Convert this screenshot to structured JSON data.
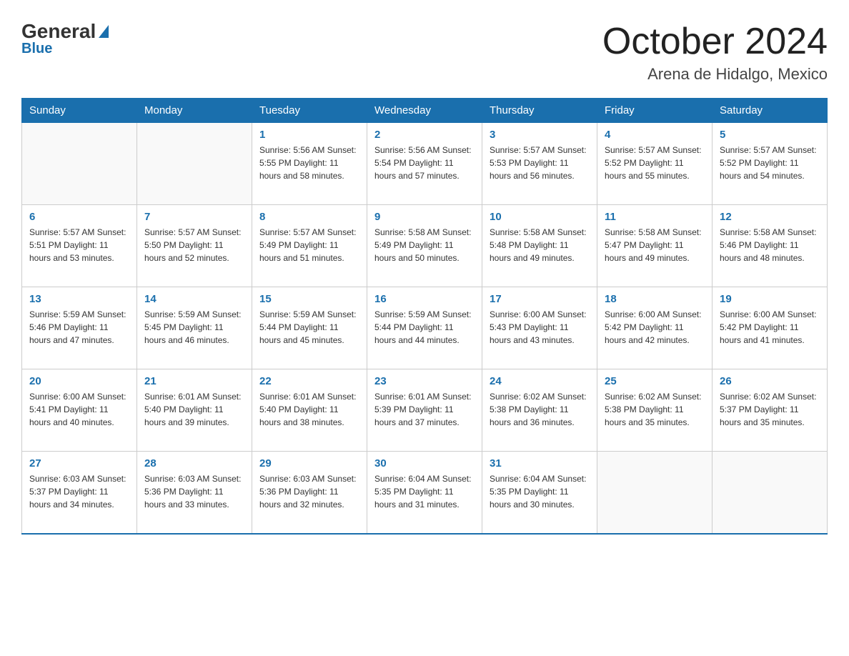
{
  "logo": {
    "general": "General",
    "blue": "Blue"
  },
  "title": "October 2024",
  "location": "Arena de Hidalgo, Mexico",
  "headers": [
    "Sunday",
    "Monday",
    "Tuesday",
    "Wednesday",
    "Thursday",
    "Friday",
    "Saturday"
  ],
  "weeks": [
    [
      {
        "day": "",
        "info": ""
      },
      {
        "day": "",
        "info": ""
      },
      {
        "day": "1",
        "info": "Sunrise: 5:56 AM\nSunset: 5:55 PM\nDaylight: 11 hours\nand 58 minutes."
      },
      {
        "day": "2",
        "info": "Sunrise: 5:56 AM\nSunset: 5:54 PM\nDaylight: 11 hours\nand 57 minutes."
      },
      {
        "day": "3",
        "info": "Sunrise: 5:57 AM\nSunset: 5:53 PM\nDaylight: 11 hours\nand 56 minutes."
      },
      {
        "day": "4",
        "info": "Sunrise: 5:57 AM\nSunset: 5:52 PM\nDaylight: 11 hours\nand 55 minutes."
      },
      {
        "day": "5",
        "info": "Sunrise: 5:57 AM\nSunset: 5:52 PM\nDaylight: 11 hours\nand 54 minutes."
      }
    ],
    [
      {
        "day": "6",
        "info": "Sunrise: 5:57 AM\nSunset: 5:51 PM\nDaylight: 11 hours\nand 53 minutes."
      },
      {
        "day": "7",
        "info": "Sunrise: 5:57 AM\nSunset: 5:50 PM\nDaylight: 11 hours\nand 52 minutes."
      },
      {
        "day": "8",
        "info": "Sunrise: 5:57 AM\nSunset: 5:49 PM\nDaylight: 11 hours\nand 51 minutes."
      },
      {
        "day": "9",
        "info": "Sunrise: 5:58 AM\nSunset: 5:49 PM\nDaylight: 11 hours\nand 50 minutes."
      },
      {
        "day": "10",
        "info": "Sunrise: 5:58 AM\nSunset: 5:48 PM\nDaylight: 11 hours\nand 49 minutes."
      },
      {
        "day": "11",
        "info": "Sunrise: 5:58 AM\nSunset: 5:47 PM\nDaylight: 11 hours\nand 49 minutes."
      },
      {
        "day": "12",
        "info": "Sunrise: 5:58 AM\nSunset: 5:46 PM\nDaylight: 11 hours\nand 48 minutes."
      }
    ],
    [
      {
        "day": "13",
        "info": "Sunrise: 5:59 AM\nSunset: 5:46 PM\nDaylight: 11 hours\nand 47 minutes."
      },
      {
        "day": "14",
        "info": "Sunrise: 5:59 AM\nSunset: 5:45 PM\nDaylight: 11 hours\nand 46 minutes."
      },
      {
        "day": "15",
        "info": "Sunrise: 5:59 AM\nSunset: 5:44 PM\nDaylight: 11 hours\nand 45 minutes."
      },
      {
        "day": "16",
        "info": "Sunrise: 5:59 AM\nSunset: 5:44 PM\nDaylight: 11 hours\nand 44 minutes."
      },
      {
        "day": "17",
        "info": "Sunrise: 6:00 AM\nSunset: 5:43 PM\nDaylight: 11 hours\nand 43 minutes."
      },
      {
        "day": "18",
        "info": "Sunrise: 6:00 AM\nSunset: 5:42 PM\nDaylight: 11 hours\nand 42 minutes."
      },
      {
        "day": "19",
        "info": "Sunrise: 6:00 AM\nSunset: 5:42 PM\nDaylight: 11 hours\nand 41 minutes."
      }
    ],
    [
      {
        "day": "20",
        "info": "Sunrise: 6:00 AM\nSunset: 5:41 PM\nDaylight: 11 hours\nand 40 minutes."
      },
      {
        "day": "21",
        "info": "Sunrise: 6:01 AM\nSunset: 5:40 PM\nDaylight: 11 hours\nand 39 minutes."
      },
      {
        "day": "22",
        "info": "Sunrise: 6:01 AM\nSunset: 5:40 PM\nDaylight: 11 hours\nand 38 minutes."
      },
      {
        "day": "23",
        "info": "Sunrise: 6:01 AM\nSunset: 5:39 PM\nDaylight: 11 hours\nand 37 minutes."
      },
      {
        "day": "24",
        "info": "Sunrise: 6:02 AM\nSunset: 5:38 PM\nDaylight: 11 hours\nand 36 minutes."
      },
      {
        "day": "25",
        "info": "Sunrise: 6:02 AM\nSunset: 5:38 PM\nDaylight: 11 hours\nand 35 minutes."
      },
      {
        "day": "26",
        "info": "Sunrise: 6:02 AM\nSunset: 5:37 PM\nDaylight: 11 hours\nand 35 minutes."
      }
    ],
    [
      {
        "day": "27",
        "info": "Sunrise: 6:03 AM\nSunset: 5:37 PM\nDaylight: 11 hours\nand 34 minutes."
      },
      {
        "day": "28",
        "info": "Sunrise: 6:03 AM\nSunset: 5:36 PM\nDaylight: 11 hours\nand 33 minutes."
      },
      {
        "day": "29",
        "info": "Sunrise: 6:03 AM\nSunset: 5:36 PM\nDaylight: 11 hours\nand 32 minutes."
      },
      {
        "day": "30",
        "info": "Sunrise: 6:04 AM\nSunset: 5:35 PM\nDaylight: 11 hours\nand 31 minutes."
      },
      {
        "day": "31",
        "info": "Sunrise: 6:04 AM\nSunset: 5:35 PM\nDaylight: 11 hours\nand 30 minutes."
      },
      {
        "day": "",
        "info": ""
      },
      {
        "day": "",
        "info": ""
      }
    ]
  ]
}
